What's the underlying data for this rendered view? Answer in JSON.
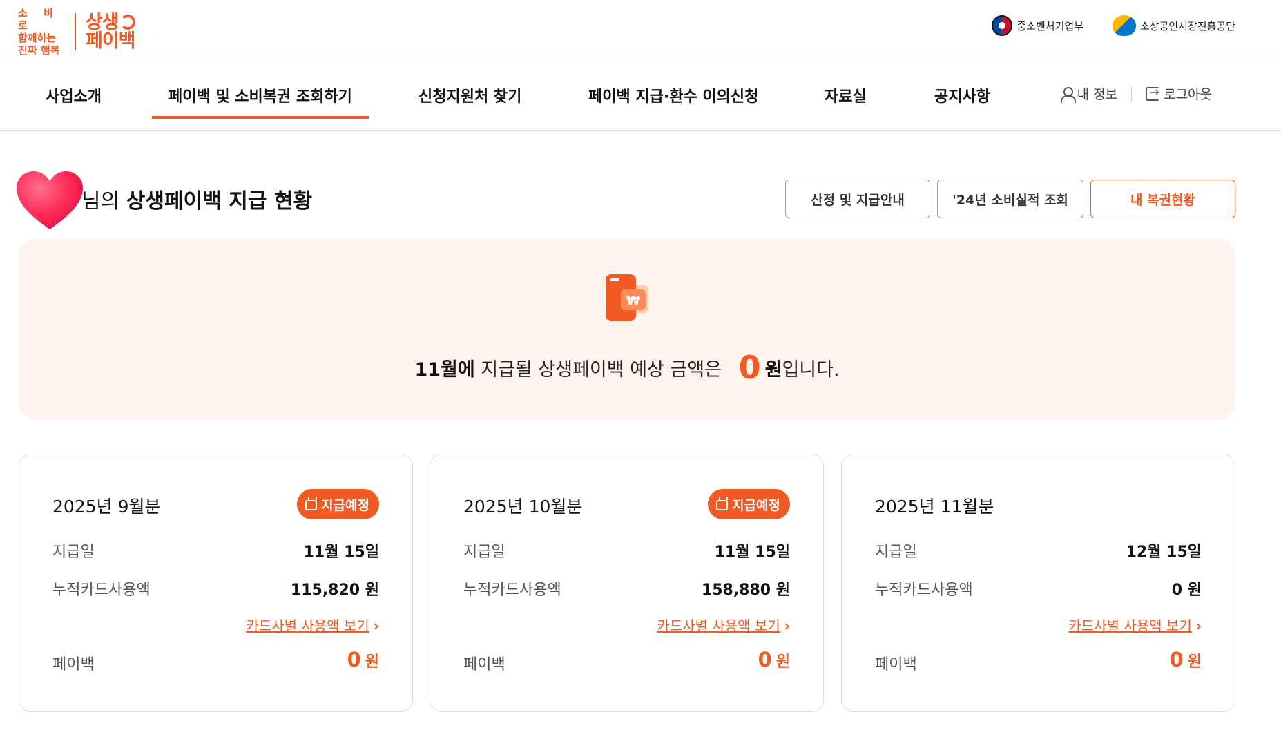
{
  "header": {
    "logo_slogan_line1": "소 비 로",
    "logo_slogan_line2": "함께하는",
    "logo_slogan_line3": "진짜 행복",
    "logo_brand_line1": "상생",
    "logo_brand_line2": "페이백",
    "orgs": [
      {
        "label": "중소벤처기업부",
        "icon": "taegeuk-emblem-icon"
      },
      {
        "label": "소상공인시장진흥공단",
        "icon": "semas-logo-icon"
      }
    ]
  },
  "nav": {
    "items": [
      {
        "label": "사업소개"
      },
      {
        "label": "페이백 및 소비복권 조회하기",
        "active": true
      },
      {
        "label": "신청지원처 찾기"
      },
      {
        "label": "페이백 지급·환수 이의신청"
      },
      {
        "label": "자료실"
      },
      {
        "label": "공지사항"
      }
    ],
    "my_info": "내 정보",
    "logout": "로그아웃"
  },
  "title": {
    "suffix": "님의",
    "main": "상생페이백 지급 현황"
  },
  "tabs": [
    {
      "label": "산정 및 지급안내"
    },
    {
      "label": "'24년 소비실적 조회"
    },
    {
      "label": "내 복권현황",
      "active": true
    }
  ],
  "banner": {
    "month": "11월에",
    "text_mid": "지급될 상생페이백 예상 금액은",
    "amount": "0",
    "unit": "원",
    "text_end": "입니다."
  },
  "cards": [
    {
      "title": "2025년 9월분",
      "badge": "지급예정",
      "pay_date_label": "지급일",
      "pay_date": "11월 15일",
      "usage_label": "누적카드사용액",
      "usage": "115,820 원",
      "link": "카드사별 사용액 보기",
      "payback_label": "페이백",
      "payback_amount": "0",
      "payback_unit": "원"
    },
    {
      "title": "2025년 10월분",
      "badge": "지급예정",
      "pay_date_label": "지급일",
      "pay_date": "11월 15일",
      "usage_label": "누적카드사용액",
      "usage": "158,880 원",
      "link": "카드사별 사용액 보기",
      "payback_label": "페이백",
      "payback_amount": "0",
      "payback_unit": "원"
    },
    {
      "title": "2025년 11월분",
      "pay_date_label": "지급일",
      "pay_date": "12월 15일",
      "usage_label": "누적카드사용액",
      "usage": "0 원",
      "link": "카드사별 사용액 보기",
      "payback_label": "페이백",
      "payback_amount": "0",
      "payback_unit": "원"
    }
  ],
  "colors": {
    "accent": "#f15a22",
    "banner_bg": "#fff3ee"
  }
}
